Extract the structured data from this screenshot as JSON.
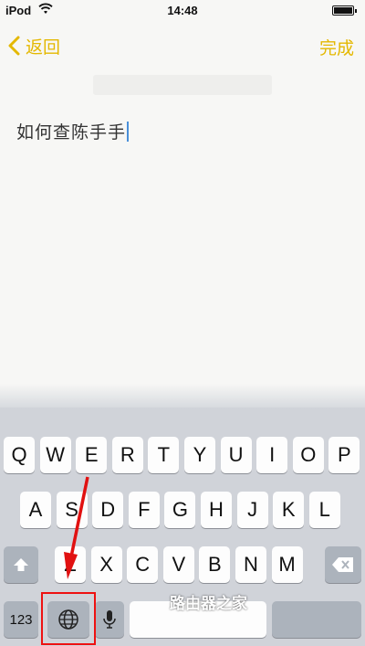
{
  "status_bar": {
    "carrier": "iPod",
    "time": "14:48",
    "icons": [
      "wifi-icon",
      "battery-icon"
    ]
  },
  "nav": {
    "back_label": "返回",
    "done_label": "完成",
    "back_icon": "chevron-left-icon"
  },
  "note": {
    "text": "如何查陈手手"
  },
  "keyboard": {
    "row1": [
      "Q",
      "W",
      "E",
      "R",
      "T",
      "Y",
      "U",
      "I",
      "O",
      "P"
    ],
    "row2": [
      "A",
      "S",
      "D",
      "F",
      "G",
      "H",
      "J",
      "K",
      "L"
    ],
    "row3": [
      "Z",
      "X",
      "C",
      "V",
      "B",
      "N",
      "M"
    ],
    "numbers_label": "123",
    "icons": [
      "shift-icon",
      "delete-icon",
      "globe-icon",
      "microphone-icon"
    ]
  },
  "annotation": {
    "watermark": "路由器之家",
    "highlight_color": "#e11111"
  },
  "colors": {
    "accent": "#e4b800",
    "keyboard_bg": "#d0d3d9",
    "key_bg": "#fdfdfd",
    "dark_key_bg": "#acb3bc"
  }
}
